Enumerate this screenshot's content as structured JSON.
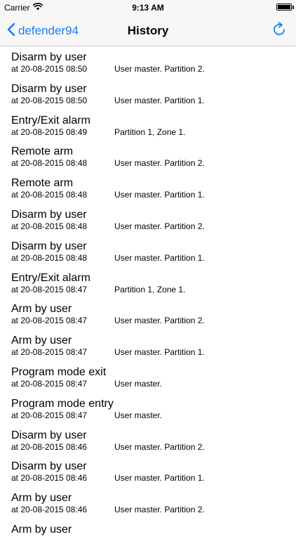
{
  "status_bar": {
    "carrier": "Carrier",
    "time": "9:13 AM",
    "wifi_icon": "wifi-icon",
    "battery_icon": "battery-icon"
  },
  "nav": {
    "back_label": "defender94",
    "title": "History",
    "back_icon": "chevron-left-icon",
    "refresh_icon": "refresh-icon",
    "accent_color": "#1a7cf5"
  },
  "history": [
    {
      "title": "Disarm by user",
      "time": "at 20-08-2015   08:50",
      "detail": "User master. Partition 2."
    },
    {
      "title": "Disarm by user",
      "time": "at 20-08-2015   08:50",
      "detail": "User master. Partition 1."
    },
    {
      "title": "Entry/Exit alarm",
      "time": "at 20-08-2015   08:49",
      "detail": "Partition 1, Zone 1."
    },
    {
      "title": "Remote arm",
      "time": "at 20-08-2015   08:48",
      "detail": "User master. Partition 2."
    },
    {
      "title": "Remote arm",
      "time": "at 20-08-2015   08:48",
      "detail": "User master. Partition 1."
    },
    {
      "title": "Disarm by user",
      "time": "at 20-08-2015   08:48",
      "detail": "User master. Partition 2."
    },
    {
      "title": "Disarm by user",
      "time": "at 20-08-2015   08:48",
      "detail": "User master. Partition 1."
    },
    {
      "title": "Entry/Exit alarm",
      "time": "at 20-08-2015   08:47",
      "detail": "Partition 1, Zone 1."
    },
    {
      "title": "Arm by user",
      "time": "at 20-08-2015   08:47",
      "detail": "User master. Partition 2."
    },
    {
      "title": "Arm by user",
      "time": "at 20-08-2015   08:47",
      "detail": "User master. Partition 1."
    },
    {
      "title": "Program mode exit",
      "time": "at 20-08-2015   08:47",
      "detail": "User master."
    },
    {
      "title": "Program mode entry",
      "time": "at 20-08-2015   08:47",
      "detail": "User master."
    },
    {
      "title": "Disarm by user",
      "time": "at 20-08-2015   08:46",
      "detail": "User master. Partition 2."
    },
    {
      "title": "Disarm by user",
      "time": "at 20-08-2015   08:46",
      "detail": "User master. Partition 1."
    },
    {
      "title": "Arm by user",
      "time": "at 20-08-2015   08:46",
      "detail": "User master. Partition 2."
    },
    {
      "title": "Arm by user",
      "time": "",
      "detail": ""
    }
  ]
}
